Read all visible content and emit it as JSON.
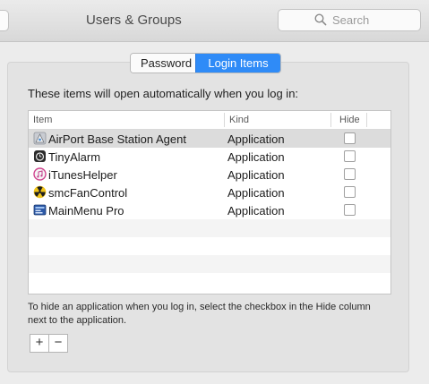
{
  "window": {
    "title": "Users & Groups"
  },
  "search": {
    "placeholder": "Search"
  },
  "tabs": [
    {
      "label": "Password",
      "selected": false
    },
    {
      "label": "Login Items",
      "selected": true
    }
  ],
  "intro": "These items will open automatically when you log in:",
  "table": {
    "columns": [
      "Item",
      "Kind",
      "Hide"
    ],
    "rows": [
      {
        "name": "AirPort Base Station Agent",
        "kind": "Application",
        "hide": false,
        "icon": "airport-icon"
      },
      {
        "name": "TinyAlarm",
        "kind": "Application",
        "hide": false,
        "icon": "tinyalarm-icon"
      },
      {
        "name": "iTunesHelper",
        "kind": "Application",
        "hide": false,
        "icon": "itunes-icon"
      },
      {
        "name": "smcFanControl",
        "kind": "Application",
        "hide": false,
        "icon": "fan-icon"
      },
      {
        "name": "MainMenu Pro",
        "kind": "Application",
        "hide": false,
        "icon": "mainmenu-icon"
      }
    ]
  },
  "hint": "To hide an application when you log in, select the checkbox in the Hide column next to the application.",
  "buttons": {
    "add": "+",
    "remove": "−"
  },
  "colors": {
    "accent": "#2f8bf7",
    "selected_row": "#dcdcdc"
  }
}
